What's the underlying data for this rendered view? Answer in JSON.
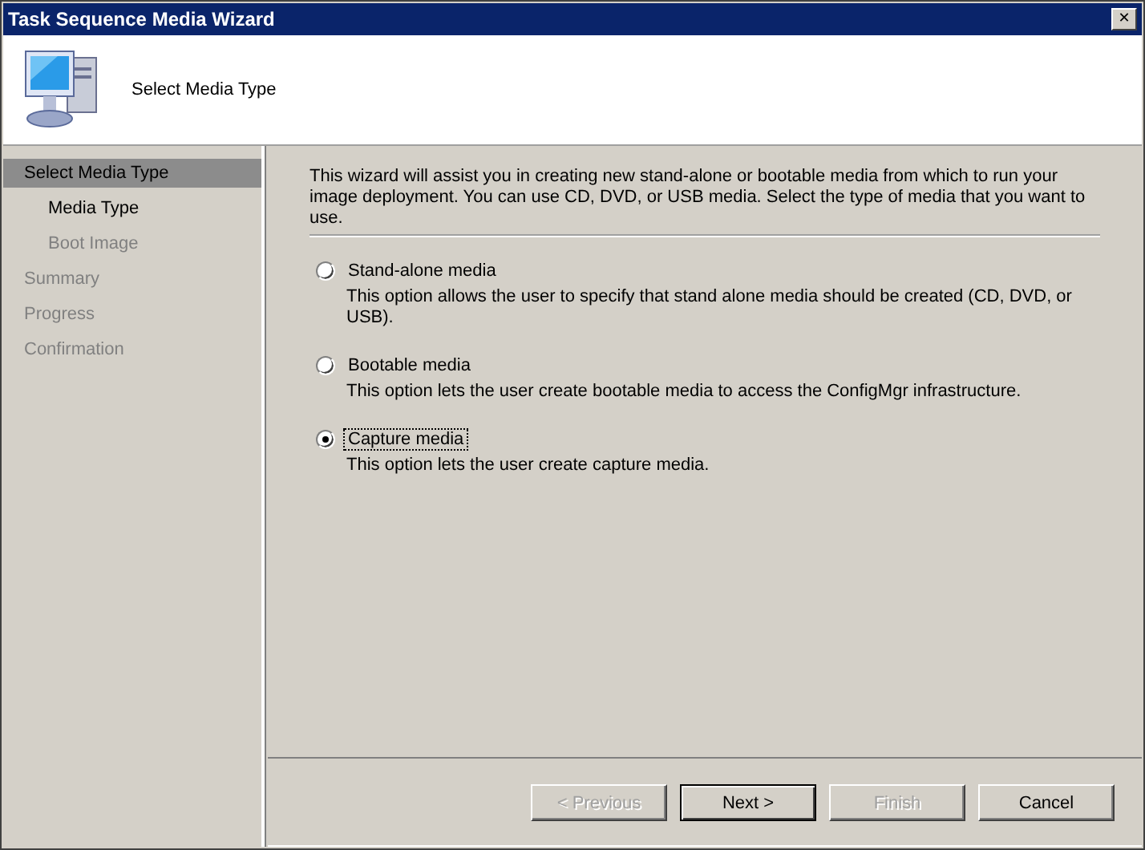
{
  "window": {
    "title": "Task Sequence Media Wizard",
    "close_glyph": "✕"
  },
  "header": {
    "title": "Select Media Type"
  },
  "sidebar": {
    "items": [
      {
        "label": "Select Media Type",
        "selected": true,
        "disabled": false,
        "children": [
          {
            "label": "Media Type",
            "selected": false,
            "disabled": false
          },
          {
            "label": "Boot Image",
            "selected": false,
            "disabled": true
          }
        ]
      },
      {
        "label": "Summary",
        "selected": false,
        "disabled": true
      },
      {
        "label": "Progress",
        "selected": false,
        "disabled": true
      },
      {
        "label": "Confirmation",
        "selected": false,
        "disabled": true
      }
    ]
  },
  "content": {
    "intro": "This wizard will assist you in creating new stand-alone or bootable media from which to run your image deployment. You can use CD, DVD, or USB media. Select the type of media that you want to use.",
    "options": [
      {
        "label": "Stand-alone media",
        "description": "This option allows the user to specify that stand alone media should be created (CD, DVD, or USB).",
        "selected": false,
        "focused": false
      },
      {
        "label": "Bootable media",
        "description": "This option lets the user create bootable media to access the ConfigMgr infrastructure.",
        "selected": false,
        "focused": false
      },
      {
        "label": "Capture media",
        "description": "This option lets the user create capture media.",
        "selected": true,
        "focused": true
      }
    ]
  },
  "buttons": [
    {
      "label": "< Previous",
      "disabled": true,
      "default": false
    },
    {
      "label": "Next >",
      "disabled": false,
      "default": true
    },
    {
      "label": "Finish",
      "disabled": true,
      "default": false
    },
    {
      "label": "Cancel",
      "disabled": false,
      "default": false
    }
  ]
}
